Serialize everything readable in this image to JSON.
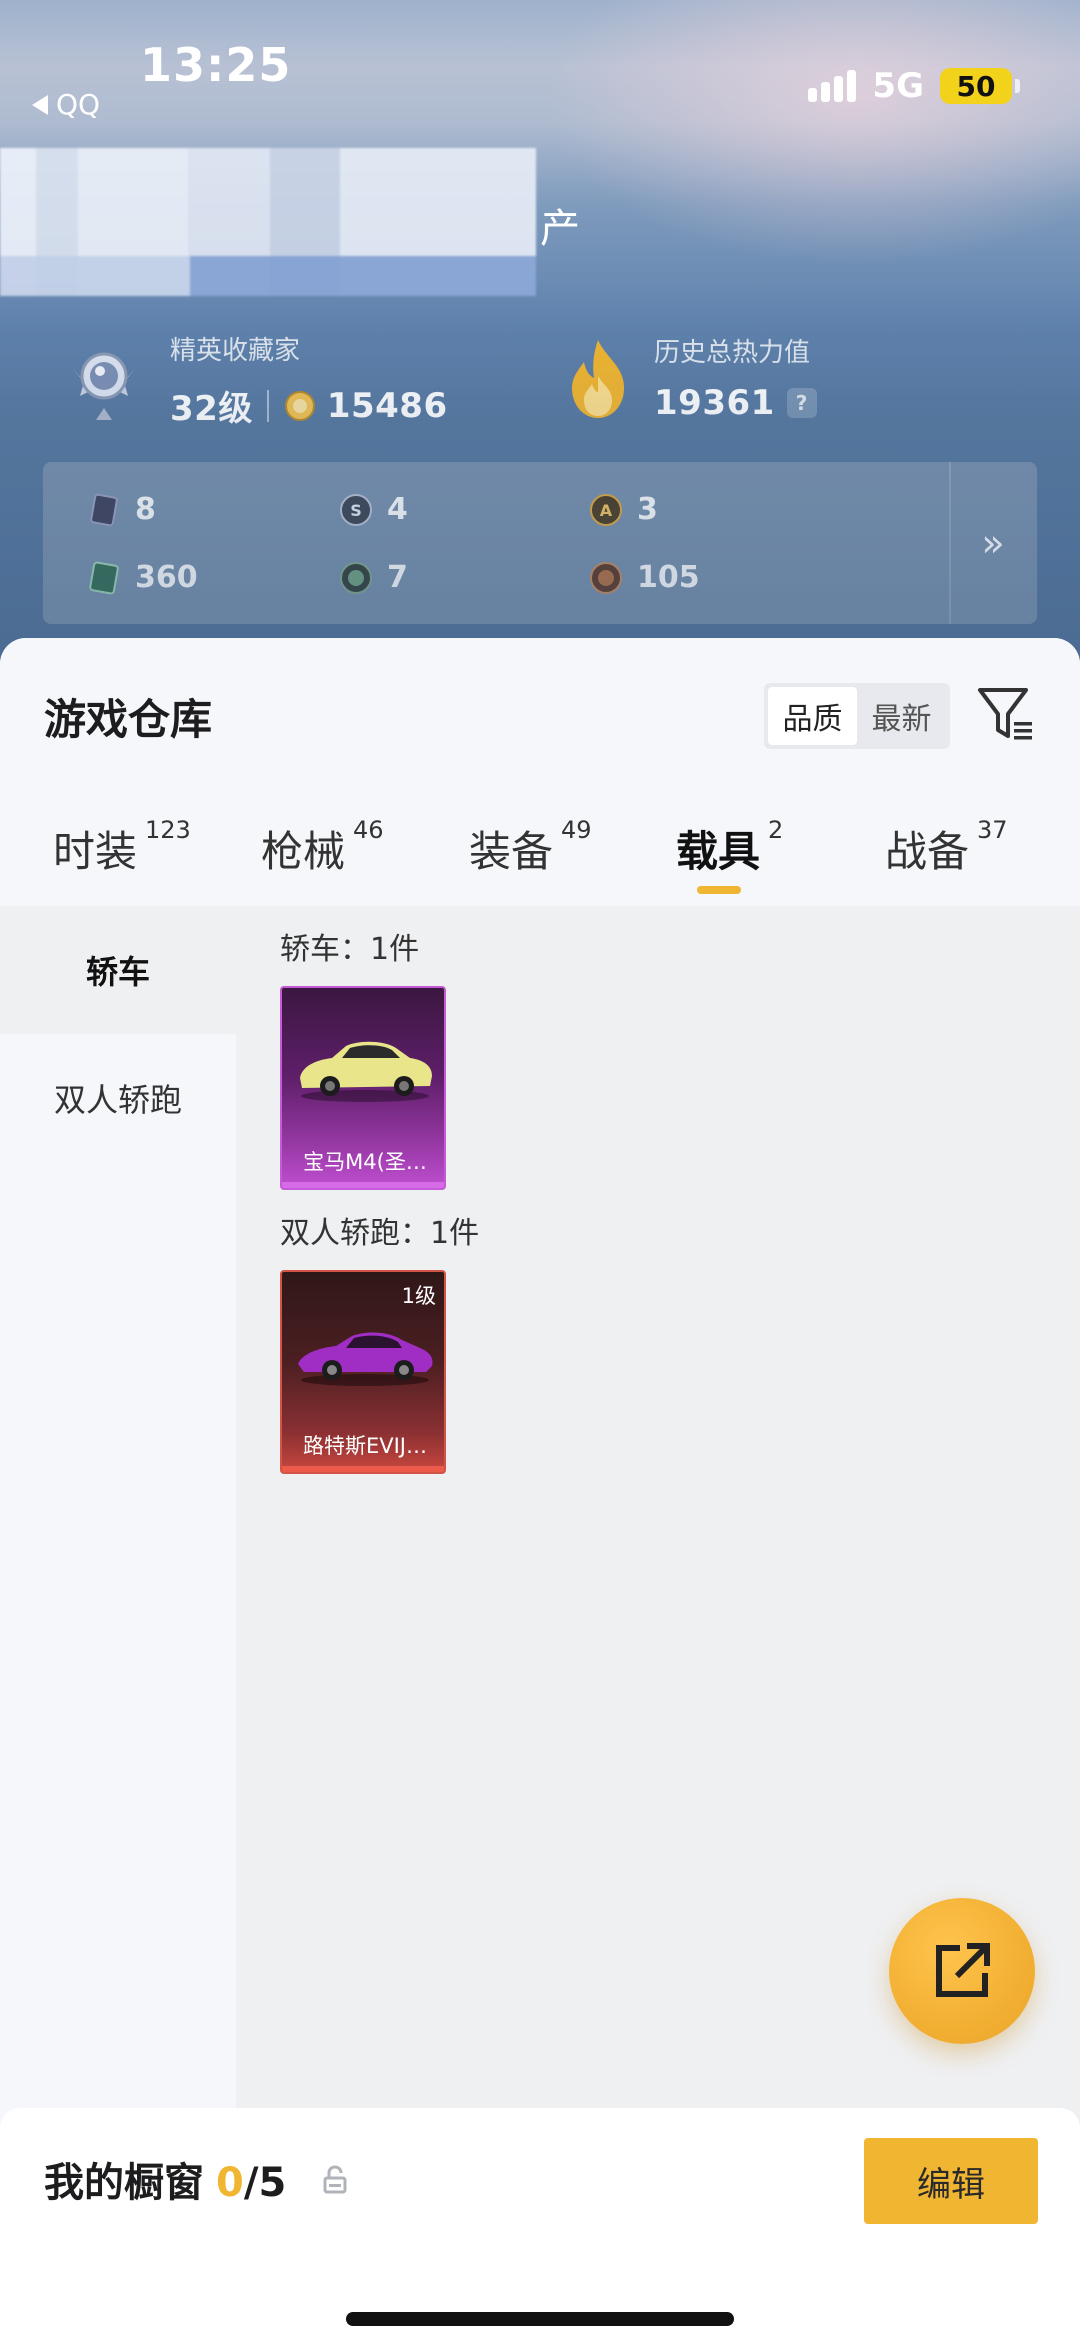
{
  "status_bar": {
    "time": "13:25",
    "back_app": "QQ",
    "network": "5G",
    "battery": "50"
  },
  "header": {
    "title_suffix": "产",
    "collector_title": "精英收藏家",
    "collector_level": "32级",
    "collector_points": "15486",
    "heat_label": "历史总热力值",
    "heat_value": "19361",
    "help_icon": "?"
  },
  "resources": [
    {
      "icon": "card-icon",
      "value": "8"
    },
    {
      "icon": "coin-s-icon",
      "value": "4"
    },
    {
      "icon": "coin-a-icon",
      "value": "3"
    },
    {
      "icon": "ticket-icon",
      "value": "360"
    },
    {
      "icon": "orb-icon",
      "value": "7"
    },
    {
      "icon": "bronze-coin-icon",
      "value": "105"
    }
  ],
  "resources_more": "»",
  "warehouse": {
    "title": "游戏仓库",
    "sort_options": [
      "品质",
      "最新"
    ],
    "sort_selected": "品质",
    "tabs": [
      {
        "label": "时装",
        "count": "123"
      },
      {
        "label": "枪械",
        "count": "46"
      },
      {
        "label": "装备",
        "count": "49"
      },
      {
        "label": "载具",
        "count": "2"
      },
      {
        "label": "战备",
        "count": "37"
      }
    ],
    "active_tab": "载具",
    "categories": [
      "轿车",
      "双人轿跑"
    ],
    "active_category": "轿车",
    "groups": [
      {
        "title": "轿车：1件",
        "items": [
          {
            "name": "宝马M4(圣…",
            "level": "",
            "color": "#c04fd1"
          }
        ]
      },
      {
        "title": "双人轿跑：1件",
        "items": [
          {
            "name": "路特斯EVIJ…",
            "level": "1级",
            "color": "#c9473f"
          }
        ]
      }
    ]
  },
  "showcase": {
    "label": "我的橱窗",
    "current": "0",
    "total": "/5",
    "edit_label": "编辑"
  },
  "colors": {
    "accent": "#f0b631",
    "purple_rarity": "#c04fd1",
    "red_rarity": "#c9473f"
  }
}
